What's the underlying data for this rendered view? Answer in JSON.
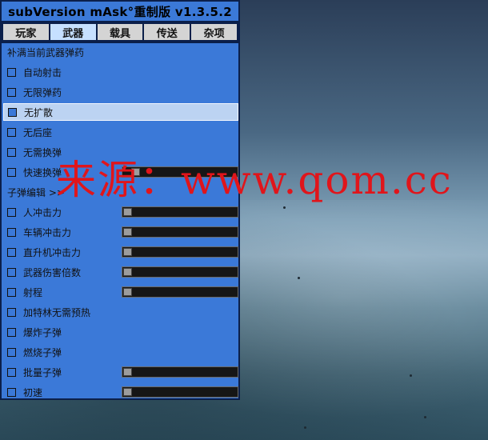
{
  "window": {
    "title": "subVersion mAsk°重制版 v1.3.5.2"
  },
  "tabs": [
    {
      "label": "玩家"
    },
    {
      "label": "武器",
      "active": true
    },
    {
      "label": "载具"
    },
    {
      "label": "传送"
    },
    {
      "label": "杂项"
    }
  ],
  "weapons_menu": {
    "refill_label": "补满当前武器弹药",
    "items": [
      {
        "label": "自动射击"
      },
      {
        "label": "无限弹药"
      },
      {
        "label": "无扩散",
        "selected": true
      },
      {
        "label": "无后座"
      },
      {
        "label": "无需换弹"
      },
      {
        "label": "快速换弹",
        "has_slider": true,
        "slider_level": 0.08
      },
      {
        "label": "子弹编辑 >>",
        "is_header": true
      },
      {
        "label": "人冲击力",
        "has_slider": true,
        "slider_level": 0
      },
      {
        "label": "车辆冲击力",
        "has_slider": true,
        "slider_level": 0
      },
      {
        "label": "直升机冲击力",
        "has_slider": true,
        "slider_level": 0
      },
      {
        "label": "武器伤害倍数",
        "has_slider": true,
        "slider_level": 0
      },
      {
        "label": "射程",
        "has_slider": true,
        "slider_level": 0
      },
      {
        "label": "加特林无需预热"
      },
      {
        "label": "爆炸子弹"
      },
      {
        "label": "燃烧子弹"
      },
      {
        "label": "批量子弹",
        "has_slider": true,
        "slider_level": 0
      },
      {
        "label": "初速",
        "has_slider": true,
        "slider_level": 0
      }
    ]
  },
  "watermark": {
    "text": "来源：www.qom.cc"
  },
  "colors": {
    "panel_bg": "#3b79d8",
    "selected_row": "#bcd3f2",
    "watermark": "#e0151b"
  }
}
